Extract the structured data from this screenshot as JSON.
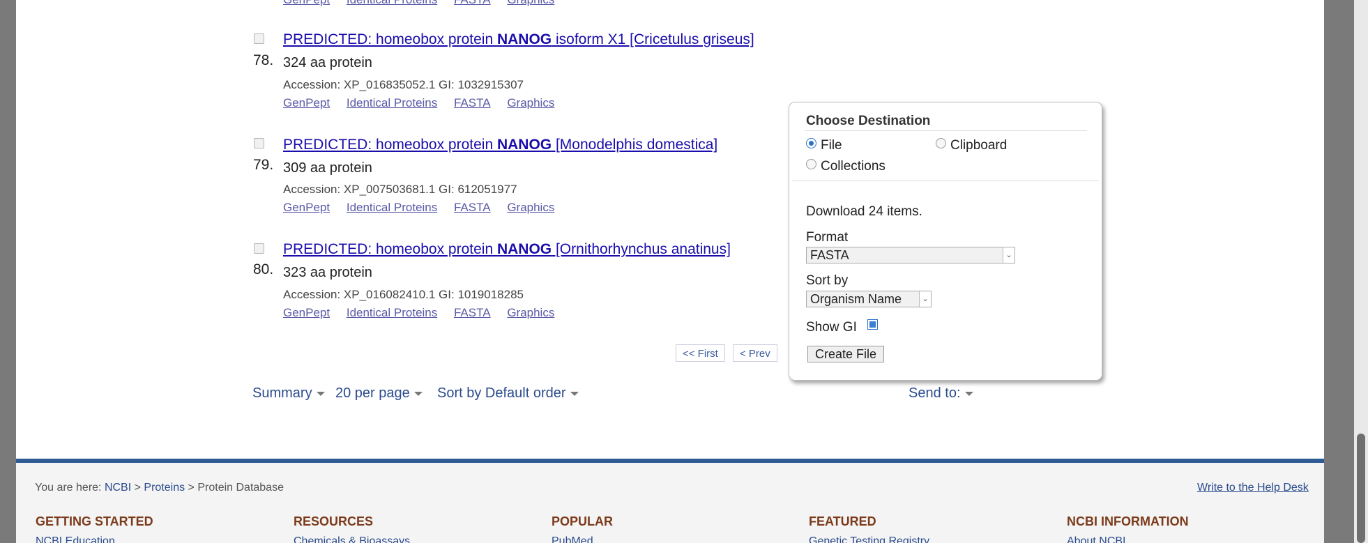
{
  "top_partial_links": [
    "GenPept",
    "Identical Proteins",
    "FASTA",
    "Graphics"
  ],
  "results": [
    {
      "number": "78.",
      "title_pre": "PREDICTED: homeobox protein ",
      "title_bold": "NANOG",
      "title_post": " isoform X1 [Cricetulus griseus]",
      "size": "324 aa protein",
      "accession": "Accession: XP_016835052.1   GI: 1032915307",
      "links": [
        "GenPept",
        "Identical Proteins",
        "FASTA",
        "Graphics"
      ]
    },
    {
      "number": "79.",
      "title_pre": "PREDICTED: homeobox protein ",
      "title_bold": "NANOG",
      "title_post": " [Monodelphis domestica]",
      "size": "309 aa protein",
      "accession": "Accession: XP_007503681.1   GI: 612051977",
      "links": [
        "GenPept",
        "Identical Proteins",
        "FASTA",
        "Graphics"
      ]
    },
    {
      "number": "80.",
      "title_pre": "PREDICTED: homeobox protein ",
      "title_bold": "NANOG",
      "title_post": " [Ornithorhynchus anatinus]",
      "size": "323 aa protein",
      "accession": "Accession: XP_016082410.1   GI: 1019018285",
      "links": [
        "GenPept",
        "Identical Proteins",
        "FASTA",
        "Graphics"
      ]
    }
  ],
  "pager": {
    "first": "<< First",
    "prev": "< Prev"
  },
  "toolbar": {
    "summary": "Summary",
    "per_page": "20 per page",
    "sort": "Sort by Default order",
    "send_to": "Send to:"
  },
  "popup": {
    "title": "Choose Destination",
    "radio_file": "File",
    "radio_clipboard": "Clipboard",
    "radio_collections": "Collections",
    "selected_destination": "File",
    "download_text": "Download 24 items.",
    "format_label": "Format",
    "format_value": "FASTA",
    "sort_label": "Sort by",
    "sort_value": "Organism Name",
    "show_gi_label": "Show GI",
    "show_gi_checked": true,
    "create_button": "Create File"
  },
  "footer": {
    "you_are_here": "You are here:",
    "crumb_ncbi": "NCBI",
    "crumb_sep": " > ",
    "crumb_proteins": "Proteins",
    "crumb_current": "Protein Database",
    "help_desk": "Write to the Help Desk",
    "columns": [
      {
        "heading": "GETTING STARTED",
        "first_link": "NCBI Education"
      },
      {
        "heading": "RESOURCES",
        "first_link": "Chemicals & Bioassays"
      },
      {
        "heading": "POPULAR",
        "first_link": "PubMed"
      },
      {
        "heading": "FEATURED",
        "first_link": "Genetic Testing Registry"
      },
      {
        "heading": "NCBI INFORMATION",
        "first_link": "About NCBI"
      }
    ]
  },
  "colors": {
    "link": "#1a0dab",
    "visited_link": "#5a5aa8",
    "nav_blue": "#2a4b8d",
    "footer_bar": "#2f5b95",
    "footer_heading": "#7b3a1a"
  }
}
